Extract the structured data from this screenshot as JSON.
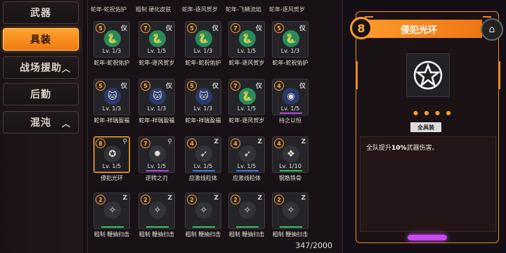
{
  "sidebar": {
    "items": [
      {
        "label": "武器"
      },
      {
        "label": "具装"
      },
      {
        "label": "战场援助"
      },
      {
        "label": "后勤"
      },
      {
        "label": "混沌"
      }
    ]
  },
  "grid": {
    "top_names": [
      "蛇年-蛇祝佑护",
      "粗制 硬化皮肤",
      "蛇年-逐风贺岁",
      "蛇年-飞鳞流焰",
      "蛇年-逐风贺岁"
    ],
    "rows": [
      {
        "cards": [
          {
            "level": "5",
            "tag": "仪",
            "lv": "Lv. 1/3",
            "icon": "snake-emblem-icon",
            "icon_color": "#2a8a5a",
            "bar": "none"
          },
          {
            "level": "7",
            "tag": "仪",
            "lv": "Lv. 1/5",
            "icon": "snake-emblem-icon",
            "icon_color": "#2a8a5a",
            "bar": "none"
          },
          {
            "level": "5",
            "tag": "仪",
            "lv": "Lv. 1/3",
            "icon": "snake-emblem-icon",
            "icon_color": "#2a8a5a",
            "bar": "none"
          },
          {
            "level": "7",
            "tag": "仪",
            "lv": "Lv. 1/5",
            "icon": "snake-emblem-icon",
            "icon_color": "#2a8a5a",
            "bar": "none"
          },
          {
            "level": "5",
            "tag": "仪",
            "lv": "Lv. 1/3",
            "icon": "snake-emblem-icon",
            "icon_color": "#2a8a5a",
            "bar": "none"
          }
        ],
        "captions": [
          "蛇年-蛇祝佑护",
          "蛇年-逐风贺岁",
          "蛇年-蛇祝佑护",
          "蛇年-逐风贺岁",
          "蛇年-蛇祝佑护"
        ]
      },
      {
        "cards": [
          {
            "level": "5",
            "tag": "仪",
            "lv": "Lv. 1/3",
            "icon": "lucky-cat-icon",
            "icon_color": "#2a3a6a",
            "bar": "none"
          },
          {
            "level": "5",
            "tag": "仪",
            "lv": "Lv. 1/3",
            "icon": "lucky-cat-icon",
            "icon_color": "#2a3a6a",
            "bar": "none"
          },
          {
            "level": "5",
            "tag": "仪",
            "lv": "Lv. 1/3",
            "icon": "lucky-cat-icon",
            "icon_color": "#2a3a6a",
            "bar": "none"
          },
          {
            "level": "7",
            "tag": "仪",
            "lv": "Lv. 1/5",
            "icon": "snake-emblem-icon",
            "icon_color": "#2a8a5a",
            "bar": "none"
          },
          {
            "level": "4",
            "tag": "仪",
            "lv": "Lv. 1/5",
            "icon": "swirl-icon",
            "icon_color": "#2a3a6a",
            "bar": "purple"
          }
        ],
        "captions": [
          "蛇年-祥瑞盈福",
          "蛇年-祥瑞盈福",
          "蛇年-祥瑞盈福",
          "蛇年-逐风贺岁",
          "持之以恒"
        ]
      },
      {
        "cards": [
          {
            "level": "8",
            "tag": "⚲",
            "lv": "Lv. 1/5",
            "icon": "star-badge-icon",
            "icon_color": "#33333a",
            "bar": "none"
          },
          {
            "level": "7",
            "tag": "⚲",
            "lv": "Lv. 1/5",
            "icon": "gear-burst-icon",
            "icon_color": "#33333a",
            "bar": "purple"
          },
          {
            "level": "4",
            "tag": "Z",
            "lv": "Lv. 1/5",
            "icon": "missile-icon",
            "icon_color": "#33333a",
            "bar": "blue"
          },
          {
            "level": "4",
            "tag": "Z",
            "lv": "Lv. 1/5",
            "icon": "missile-icon",
            "icon_color": "#33333a",
            "bar": "blue"
          },
          {
            "level": "4",
            "tag": "Z",
            "lv": "Lv. 1/10",
            "icon": "sparkle-cluster-icon",
            "icon_color": "#33333a",
            "bar": "green"
          }
        ],
        "captions": [
          "侵犯光环",
          "逆转之刃",
          "应激线粒体",
          "应激线粒体",
          "钢筋铁骨"
        ]
      },
      {
        "cards": [
          {
            "level": "2",
            "tag": "Z",
            "lv": "",
            "icon": "diamond-sparkle-icon",
            "icon_color": "#33333a",
            "bar": "green"
          },
          {
            "level": "2",
            "tag": "Z",
            "lv": "",
            "icon": "diamond-sparkle-icon",
            "icon_color": "#33333a",
            "bar": "green"
          },
          {
            "level": "2",
            "tag": "Z",
            "lv": "",
            "icon": "diamond-sparkle-icon",
            "icon_color": "#33333a",
            "bar": "green"
          },
          {
            "level": "2",
            "tag": "Z",
            "lv": "",
            "icon": "diamond-sparkle-icon",
            "icon_color": "#33333a",
            "bar": "green"
          },
          {
            "level": "2",
            "tag": "Z",
            "lv": "",
            "icon": "diamond-sparkle-icon",
            "icon_color": "#33333a",
            "bar": "green"
          }
        ],
        "captions": [
          "粗制 鞭抽扫击",
          "粗制 鞭抽扫击",
          "粗制 鞭抽扫击",
          "粗制 鞭抽扫击",
          "粗制 鞭抽扫击"
        ]
      }
    ],
    "counter": "347/2000"
  },
  "detail": {
    "level": "8",
    "title": "侵犯光环",
    "category_tag": "全具装",
    "desc_prefix": "全队提升",
    "desc_highlight": "10%",
    "desc_suffix": "武器伤害。"
  },
  "colors": {
    "accent": "#ff9c2c",
    "selected_border": "#ffb23a",
    "purple_bar": "#b04ae0",
    "blue_bar": "#3c7ae0",
    "green_bar": "#3ac060"
  }
}
